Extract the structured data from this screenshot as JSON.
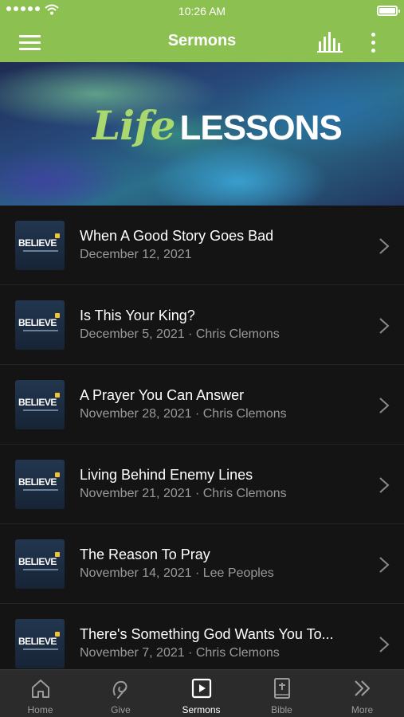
{
  "status_bar": {
    "time": "10:26 AM",
    "signal_icon": "signal-dots-icon",
    "wifi_icon": "wifi-icon",
    "battery_icon": "battery-icon"
  },
  "navbar": {
    "title": "Sermons",
    "menu_icon": "hamburger-menu-icon",
    "bars_icon": "audio-bars-icon",
    "more_icon": "vertical-ellipsis-icon",
    "background": "#8cc152"
  },
  "banner": {
    "script_text": "Life",
    "bold_text": "LESSONS",
    "script_color": "#a9d86e"
  },
  "sermons": [
    {
      "title": "When A Good Story Goes Bad",
      "meta": "December 12, 2021",
      "thumb_text": "BELIEVE"
    },
    {
      "title": "Is This Your King?",
      "meta": "December 5, 2021 · Chris Clemons",
      "thumb_text": "BELIEVE"
    },
    {
      "title": "A Prayer You Can Answer",
      "meta": "November 28, 2021 · Chris Clemons",
      "thumb_text": "BELIEVE"
    },
    {
      "title": "Living Behind Enemy Lines",
      "meta": "November 21, 2021 · Chris Clemons",
      "thumb_text": "BELIEVE"
    },
    {
      "title": "The Reason To Pray",
      "meta": "November 14, 2021 · Lee Peoples",
      "thumb_text": "BELIEVE"
    },
    {
      "title": "There's Something God Wants You To...",
      "meta": "November 7, 2021 · Chris Clemons",
      "thumb_text": "BELIEVE"
    }
  ],
  "tabbar": {
    "tabs": [
      {
        "label": "Home",
        "icon": "home-icon",
        "active": false
      },
      {
        "label": "Give",
        "icon": "give-icon",
        "active": false
      },
      {
        "label": "Sermons",
        "icon": "play-square-icon",
        "active": true
      },
      {
        "label": "Bible",
        "icon": "bible-icon",
        "active": false
      },
      {
        "label": "More",
        "icon": "double-chevron-right-icon",
        "active": false
      }
    ],
    "active_color": "#ffffff",
    "inactive_color": "#9b9b9b"
  }
}
